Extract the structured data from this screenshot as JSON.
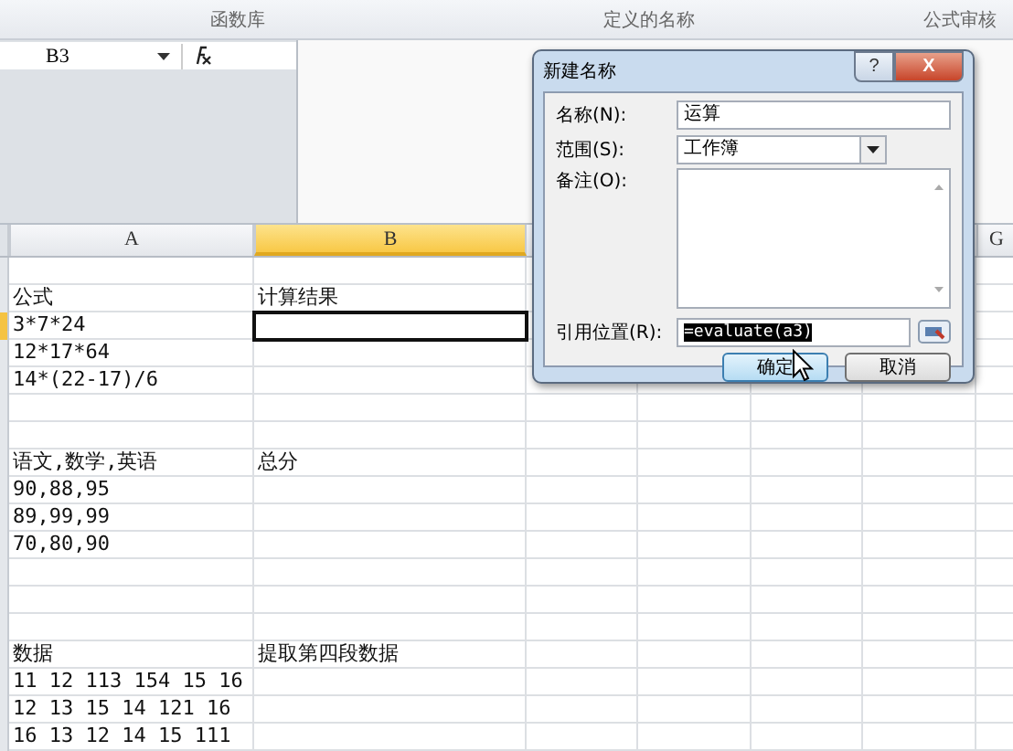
{
  "ribbon_groups": [
    "函数库",
    "定义的名称",
    "公式审核"
  ],
  "name_box": {
    "value": "B3"
  },
  "columns": [
    {
      "label": "A",
      "selected": false
    },
    {
      "label": "B",
      "selected": true
    },
    {
      "label": "G",
      "selected": false
    }
  ],
  "rows": [
    {
      "a": "",
      "b": "",
      "selected": false
    },
    {
      "a": "公式",
      "b": "计算结果",
      "selected": false
    },
    {
      "a": "3*7*24",
      "b": "",
      "selected": true
    },
    {
      "a": "12*17*64",
      "b": "",
      "selected": false
    },
    {
      "a": "14*(22-17)/6",
      "b": "",
      "selected": false
    },
    {
      "a": "",
      "b": "",
      "selected": false
    },
    {
      "a": "",
      "b": "",
      "selected": false
    },
    {
      "a": "语文,数学,英语",
      "b": "总分",
      "selected": false
    },
    {
      "a": "90,88,95",
      "b": "",
      "selected": false
    },
    {
      "a": "89,99,99",
      "b": "",
      "selected": false
    },
    {
      "a": "70,80,90",
      "b": "",
      "selected": false
    },
    {
      "a": "",
      "b": "",
      "selected": false
    },
    {
      "a": "",
      "b": "",
      "selected": false
    },
    {
      "a": "",
      "b": "",
      "selected": false
    },
    {
      "a": "数据",
      "b": "提取第四段数据",
      "selected": false
    },
    {
      "a": "11 12 113 154 15 16",
      "b": "",
      "selected": false
    },
    {
      "a": "12 13 15 14 121 16",
      "b": "",
      "selected": false
    },
    {
      "a": "16 13 12 14 15 111",
      "b": "",
      "selected": false
    }
  ],
  "dialog": {
    "title": "新建名称",
    "help": "?",
    "close": "X",
    "name_label": "名称(N):",
    "name_value": "运算",
    "scope_label": "范围(S):",
    "scope_value": "工作簿",
    "comment_label": "备注(O):",
    "ref_label": "引用位置(R):",
    "ref_value": "=evaluate(a3)",
    "ok": "确定",
    "cancel": "取消"
  }
}
